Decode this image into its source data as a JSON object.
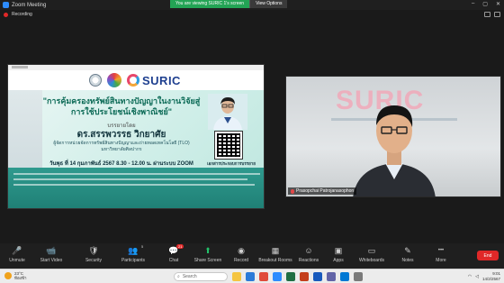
{
  "window": {
    "title": "Zoom Meeting",
    "banner_text": "You are viewing SURIC 1's screen",
    "view_options": "View Options",
    "win_controls": [
      "–",
      "▢",
      "✕"
    ]
  },
  "recording": {
    "label": "Recording"
  },
  "slide": {
    "logo_word": "SURIC",
    "title": "\"การคุ้มครองทรัพย์สินทางปัญญาในงานวิจัยสู่การใช้ประโยชน์เชิงพาณิชย์\"",
    "by": "บรรยายโดย",
    "speaker": "ดร.สรรพวรรธ วิกยาศัย",
    "position1": "ผู้จัดการหน่วยจัดการทรัพย์สินทางปัญญาและถ่ายทอดเทคโนโลยี (TLO)",
    "position2": "มหาวิทยาลัยศิลปากร",
    "date": "วันพุธ ที่ 14 กุมภาพันธ์ 2567 8.30 - 12.00 น. ผ่านระบบ ZOOM",
    "qr_label": "เอกสารประกอบการบรรยาย"
  },
  "camera": {
    "bg_word": "SURIC",
    "participant_name": "Prasopchai Patrojanasophon"
  },
  "toolbar": {
    "items": [
      {
        "label": "Unmute",
        "icon": "mic-off-icon",
        "glyph": "🎤"
      },
      {
        "label": "Start Video",
        "icon": "video-off-icon",
        "glyph": "📹"
      },
      {
        "label": "Security",
        "icon": "shield-icon",
        "glyph": "🛡"
      },
      {
        "label": "Participants",
        "icon": "participants-icon",
        "glyph": "👥"
      },
      {
        "label": "Chat",
        "icon": "chat-icon",
        "glyph": "💬"
      },
      {
        "label": "Share Screen",
        "icon": "share-screen-icon",
        "glyph": "⬆"
      },
      {
        "label": "Record",
        "icon": "record-icon",
        "glyph": "◉"
      },
      {
        "label": "Breakout Rooms",
        "icon": "breakout-icon",
        "glyph": "▦"
      },
      {
        "label": "Reactions",
        "icon": "reactions-icon",
        "glyph": "☺"
      },
      {
        "label": "Apps",
        "icon": "apps-icon",
        "glyph": "▣"
      },
      {
        "label": "Whiteboards",
        "icon": "whiteboard-icon",
        "glyph": "▭"
      },
      {
        "label": "Notes",
        "icon": "notes-icon",
        "glyph": "✎"
      },
      {
        "label": "More",
        "icon": "more-icon",
        "glyph": "•••"
      }
    ],
    "participants_count": "5",
    "chat_badge": "21",
    "end_label": "End"
  },
  "taskbar": {
    "temp": "23°C",
    "weather": "ท้องฟ้า",
    "search_placeholder": "Search",
    "time": "9:01",
    "date": "14/2/2567"
  }
}
